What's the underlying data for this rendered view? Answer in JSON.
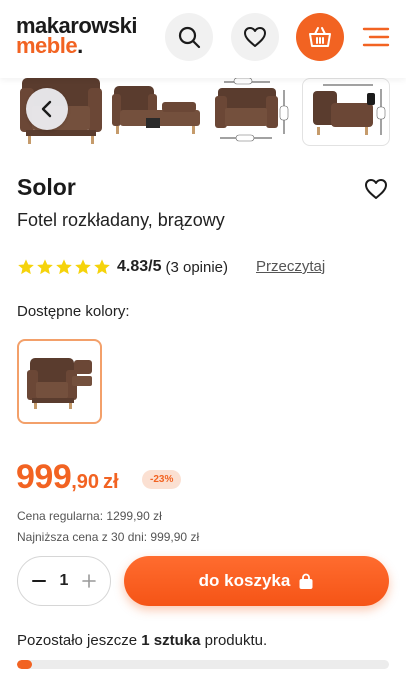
{
  "header": {
    "logo_line1": "makarowski",
    "logo_line2": "meble",
    "logo_dot": ".",
    "icons": [
      "search-icon",
      "heart-icon",
      "basket-icon",
      "menu-icon"
    ],
    "accent_color": "#f26322"
  },
  "gallery": {
    "thumbnails": [
      "armchair-front",
      "armchair-unfolded",
      "armchair-dimensions-front",
      "armchair-dimensions-side"
    ],
    "prev_icon": "chevron-left-icon"
  },
  "product": {
    "name": "Solor",
    "subtitle": "Fotel rozkładany, brązowy",
    "rating": {
      "stars": 5,
      "score": "4.83/5",
      "count": "(3 opinie)",
      "read_link": "Przeczytaj"
    },
    "colors_label": "Dostępne kolory:",
    "price": {
      "integer": "999",
      "decimal": ",90",
      "currency": "zł",
      "discount": "-23%",
      "regular": "Cena regularna: 1299,90 zł",
      "lowest": "Najniższa cena z 30 dni: 999,90 zł"
    },
    "quantity": "1",
    "add_to_cart": "do koszyka",
    "stock": {
      "prefix": "Pozostało jeszcze",
      "amount": "1 sztuka",
      "suffix": "produktu.",
      "level": 0.04
    }
  }
}
